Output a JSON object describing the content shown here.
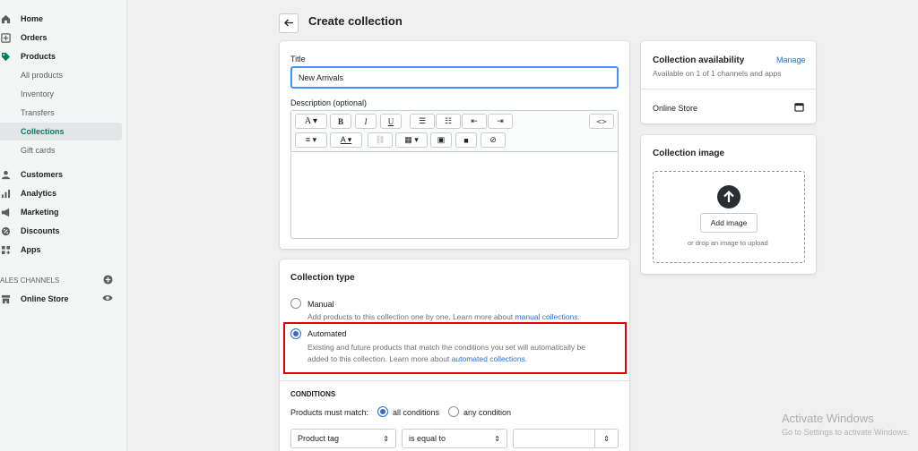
{
  "sidebar": {
    "items": [
      {
        "label": "Home",
        "icon": "home-icon"
      },
      {
        "label": "Orders",
        "icon": "orders-icon"
      },
      {
        "label": "Products",
        "icon": "tag-icon"
      },
      {
        "label": "Customers",
        "icon": "person-icon"
      },
      {
        "label": "Analytics",
        "icon": "bar-chart-icon"
      },
      {
        "label": "Marketing",
        "icon": "megaphone-icon"
      },
      {
        "label": "Discounts",
        "icon": "discount-icon"
      },
      {
        "label": "Apps",
        "icon": "apps-icon"
      }
    ],
    "product_sub": [
      "All products",
      "Inventory",
      "Transfers",
      "Collections",
      "Gift cards"
    ],
    "channels_label": "ALES CHANNELS",
    "online_store": "Online Store"
  },
  "header": {
    "title": "Create collection"
  },
  "form": {
    "title_label": "Title",
    "title_value": "New Arrivals",
    "description_label": "Description (optional)"
  },
  "collection_type": {
    "heading": "Collection type",
    "manual_label": "Manual",
    "manual_help": "Add products to this collection one by one. Learn more about ",
    "manual_link": "manual collections",
    "manual_tail": ".",
    "automated_label": "Automated",
    "automated_help_1": "Existing and future products that match the conditions you set will automatically be",
    "automated_help_2": "added to this collection. Learn more about ",
    "automated_link": "automated collections",
    "automated_tail": ".",
    "selected": "Automated"
  },
  "conditions": {
    "heading": "CONDITIONS",
    "must_match_label": "Products must match:",
    "all_label": "all conditions",
    "any_label": "any condition",
    "field": "Product tag",
    "operator": "is equal to",
    "value": ""
  },
  "availability": {
    "title": "Collection availability",
    "manage": "Manage",
    "subtitle": "Available on 1 of 1 channels and apps",
    "channel": "Online Store"
  },
  "image": {
    "title": "Collection image",
    "add_button": "Add image",
    "drop_hint": "or drop an image to upload"
  },
  "watermark": {
    "line1": "Activate Windows",
    "line2": "Go to Settings to activate Windows."
  },
  "colors": {
    "accent": "#2c6ecb",
    "active_nav": "#007f5f",
    "highlight": "#e2000f"
  }
}
